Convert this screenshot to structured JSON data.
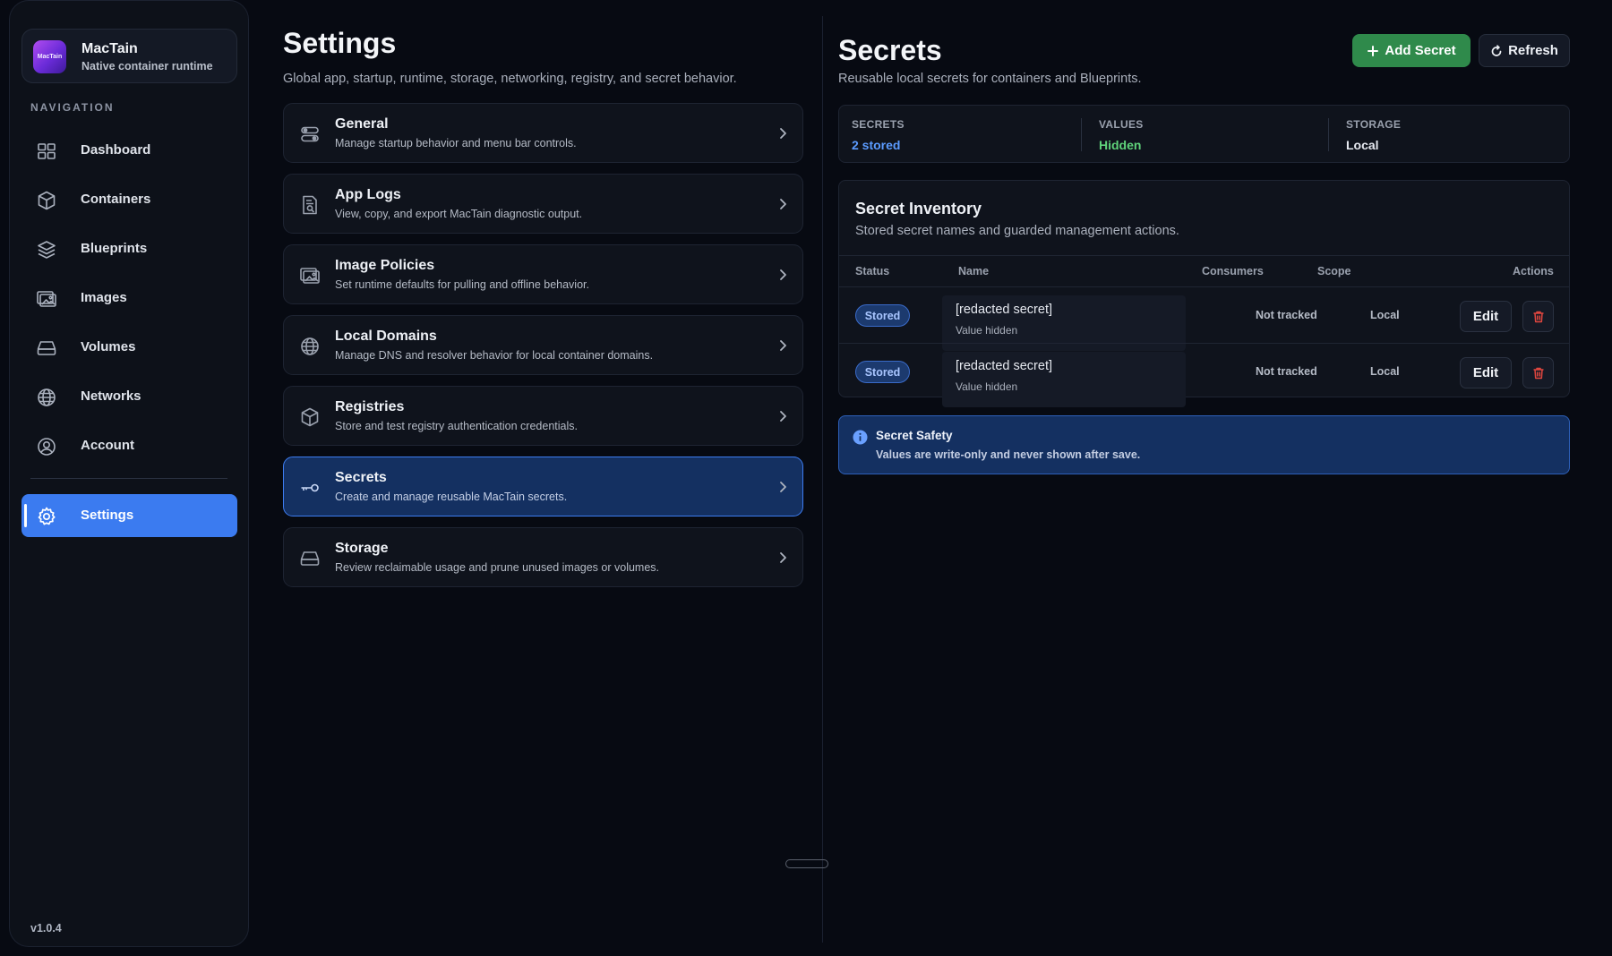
{
  "app": {
    "name": "MacTain",
    "subtitle": "Native container runtime",
    "logo_text": "MacTain",
    "version": "v1.0.4"
  },
  "sidebar": {
    "heading": "NAVIGATION",
    "items": [
      {
        "label": "Dashboard",
        "icon": "grid-icon"
      },
      {
        "label": "Containers",
        "icon": "cube-icon"
      },
      {
        "label": "Blueprints",
        "icon": "layers-icon"
      },
      {
        "label": "Images",
        "icon": "images-icon"
      },
      {
        "label": "Volumes",
        "icon": "drive-icon"
      },
      {
        "label": "Networks",
        "icon": "globe-icon"
      },
      {
        "label": "Account",
        "icon": "user-circle-icon"
      }
    ],
    "active_item": {
      "label": "Settings",
      "icon": "gear-icon"
    }
  },
  "settings": {
    "title": "Settings",
    "subtitle": "Global app, startup, runtime, storage, networking, registry, and secret behavior.",
    "cards": [
      {
        "title": "General",
        "desc": "Manage startup behavior and menu bar controls.",
        "icon": "toggles-icon"
      },
      {
        "title": "App Logs",
        "desc": "View, copy, and export MacTain diagnostic output.",
        "icon": "document-search-icon"
      },
      {
        "title": "Image Policies",
        "desc": "Set runtime defaults for pulling and offline behavior.",
        "icon": "images-icon"
      },
      {
        "title": "Local Domains",
        "desc": "Manage DNS and resolver behavior for local container domains.",
        "icon": "globe-icon"
      },
      {
        "title": "Registries",
        "desc": "Store and test registry authentication credentials.",
        "icon": "cube-icon"
      },
      {
        "title": "Secrets",
        "desc": "Create and manage reusable MacTain secrets.",
        "icon": "key-icon",
        "active": true
      },
      {
        "title": "Storage",
        "desc": "Review reclaimable usage and prune unused images or volumes.",
        "icon": "drive-icon"
      }
    ]
  },
  "secrets": {
    "title": "Secrets",
    "subtitle": "Reusable local secrets for containers and Blueprints.",
    "add_label": "Add Secret",
    "refresh_label": "Refresh",
    "stats": [
      {
        "key": "SECRETS",
        "value": "2 stored",
        "color": "#5b9bff"
      },
      {
        "key": "VALUES",
        "value": "Hidden",
        "color": "#5fd37a"
      },
      {
        "key": "STORAGE",
        "value": "Local",
        "color": "#e6e9f0"
      }
    ],
    "inventory": {
      "title": "Secret Inventory",
      "subtitle": "Stored secret names and guarded management actions.",
      "columns": {
        "status": "Status",
        "name": "Name",
        "consumers": "Consumers",
        "scope": "Scope",
        "actions": "Actions"
      },
      "rows": [
        {
          "status": "Stored",
          "name": "[redacted secret]",
          "hint": "Value hidden",
          "consumers": "Not tracked",
          "scope": "Local",
          "edit": "Edit"
        },
        {
          "status": "Stored",
          "name": "[redacted secret]",
          "hint": "Value hidden",
          "consumers": "Not tracked",
          "scope": "Local",
          "edit": "Edit"
        }
      ]
    },
    "safety": {
      "title": "Secret Safety",
      "desc": "Values are write-only and never shown after save."
    }
  },
  "colors": {
    "accent": "#3b7bf0",
    "success": "#2f8a4b",
    "danger": "#e0463f",
    "background": "#070a12"
  }
}
